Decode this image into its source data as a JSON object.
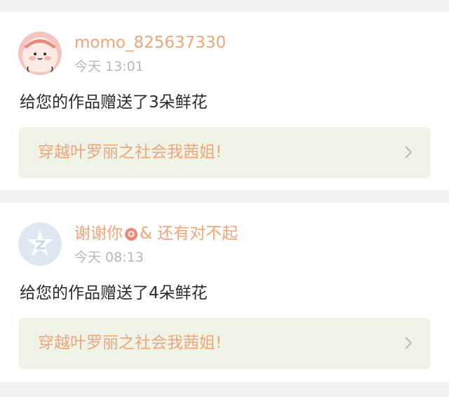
{
  "notifications": [
    {
      "username": "momo_825637330",
      "time": "今天 13:01",
      "message": "给您的作品赠送了3朵鲜花",
      "work_title": "穿越叶罗丽之社会我茜姐!",
      "avatar_icon": "cartoon-pig-avatar"
    },
    {
      "username_part1": "谢谢你",
      "username_part2": "& 还有对不起",
      "time": "今天 08:13",
      "message": "给您的作品赠送了4朵鲜花",
      "work_title": "穿越叶罗丽之社会我茜姐!",
      "avatar_icon": "default-z-avatar"
    }
  ],
  "colors": {
    "accent": "#f0a57a",
    "link_bg": "#f0f4e7",
    "muted": "#b9b9b9",
    "text": "#2b2b2b"
  }
}
